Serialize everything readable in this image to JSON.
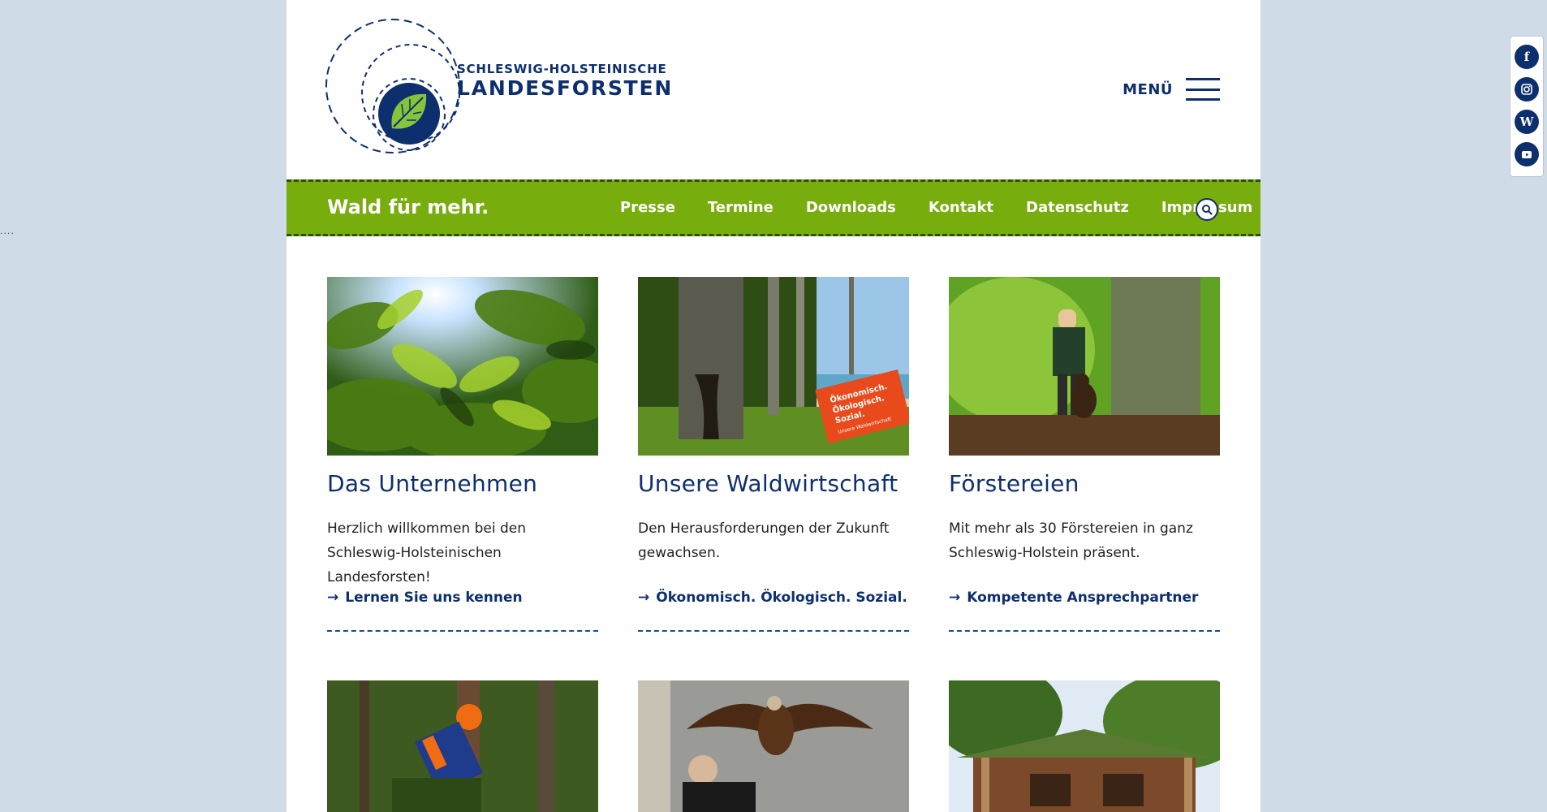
{
  "header": {
    "brand_top": "SCHLESWIG-HOLSTEINISCHE",
    "brand_main": "LANDESFORSTEN",
    "menu_label": "MENÜ",
    "logo_icon": "leaf-icon"
  },
  "nav": {
    "tagline": "Wald für mehr.",
    "links": [
      "Presse",
      "Termine",
      "Downloads",
      "Kontakt",
      "Datenschutz",
      "Impressum"
    ],
    "search_icon": "search-icon"
  },
  "cards": [
    {
      "title": "Das Unternehmen",
      "text": "Herzlich willkommen bei den Schleswig-Holsteinischen Landesforsten!",
      "link": "Lernen Sie uns kennen",
      "image": "sunlit-foliage"
    },
    {
      "title": "Unsere Waldwirtschaft",
      "text": "Den Herausforderungen der Zukunft gewachsen.",
      "link": "Ökonomisch. Ökologisch. Sozial.",
      "image": "beech-forest-coast"
    },
    {
      "title": "Förstereien",
      "text": "Mit mehr als 30 Förstereien in ganz Schleswig-Holstein präsent.",
      "link": "Kompetente Ansprechpartner",
      "image": "forester-with-dog"
    }
  ],
  "cards_row2": [
    {
      "image": "forest-worker-chainsaw"
    },
    {
      "image": "eagle-falconer"
    },
    {
      "image": "log-cabin"
    }
  ],
  "badge": {
    "line1": "Ökonomisch.",
    "line2": "Ökologisch.",
    "line3": "Sozial.",
    "line4": "Unsere Waldwirtschaft"
  },
  "sidebar_marker": "....",
  "social": [
    "facebook-icon",
    "instagram-icon",
    "wikipedia-icon",
    "youtube-icon"
  ],
  "colors": {
    "primary": "#0d2f6e",
    "green": "#77ad0c",
    "link_blue": "#0d4ea8",
    "background": "#cfdbe6"
  }
}
